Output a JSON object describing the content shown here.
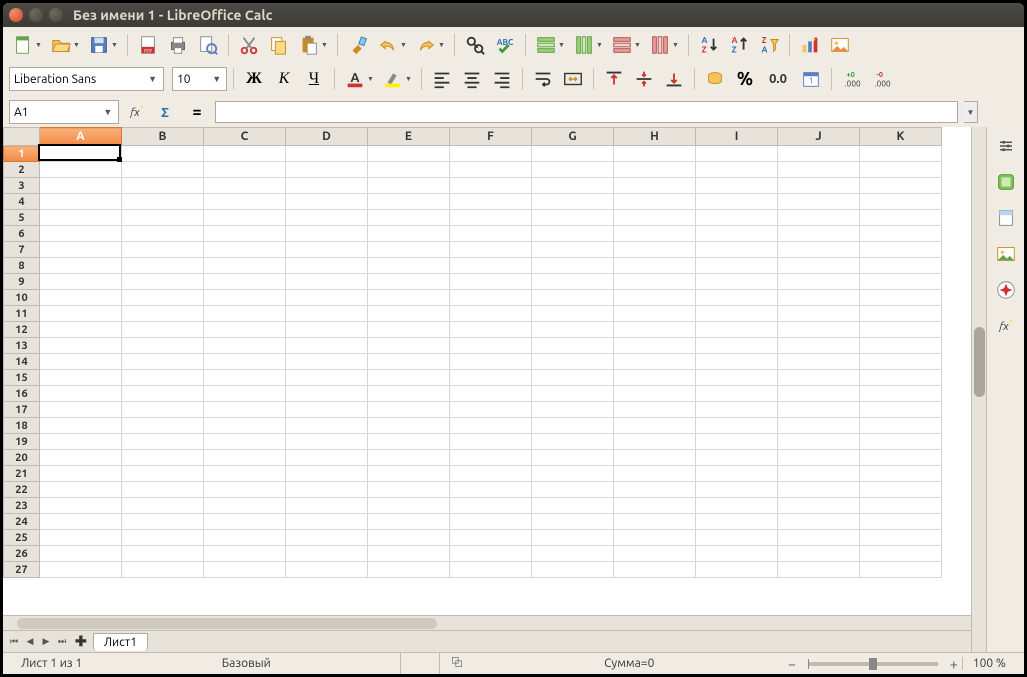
{
  "window": {
    "title": "Без имени 1 - LibreOffice Calc"
  },
  "font": {
    "name": "Liberation Sans",
    "size": "10"
  },
  "namebox": {
    "value": "A1"
  },
  "formula": {
    "value": ""
  },
  "columns": [
    "A",
    "B",
    "C",
    "D",
    "E",
    "F",
    "G",
    "H",
    "I",
    "J",
    "K"
  ],
  "rows": [
    "1",
    "2",
    "3",
    "4",
    "5",
    "6",
    "7",
    "8",
    "9",
    "10",
    "11",
    "12",
    "13",
    "14",
    "15",
    "16",
    "17",
    "18",
    "19",
    "20",
    "21",
    "22",
    "23",
    "24",
    "25",
    "26",
    "27"
  ],
  "selected": {
    "col": "A",
    "row": "1"
  },
  "tabs": {
    "sheet1": "Лист1"
  },
  "status": {
    "sheet_info": "Лист 1 из 1",
    "style": "Базовый",
    "sum": "Сумма=0",
    "zoom": "100 %"
  },
  "format_text": {
    "decimal_label": "0.0"
  },
  "icons": {
    "percent": "%",
    "equals": "="
  }
}
